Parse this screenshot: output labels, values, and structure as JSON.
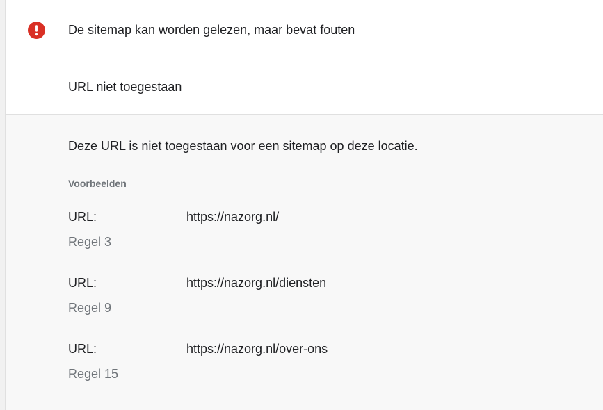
{
  "header": {
    "icon": "error-icon",
    "icon_color": "#d93025",
    "title": "De sitemap kan worden gelezen, maar bevat fouten"
  },
  "issue": {
    "title": "URL niet toegestaan"
  },
  "details": {
    "description": "Deze URL is niet toegestaan voor een sitemap op deze locatie.",
    "examples_label": "Voorbeelden",
    "examples": [
      {
        "key": "URL:",
        "url": "https://nazorg.nl/",
        "line": "Regel 3"
      },
      {
        "key": "URL:",
        "url": "https://nazorg.nl/diensten",
        "line": "Regel 9"
      },
      {
        "key": "URL:",
        "url": "https://nazorg.nl/over-ons",
        "line": "Regel 15"
      }
    ]
  }
}
